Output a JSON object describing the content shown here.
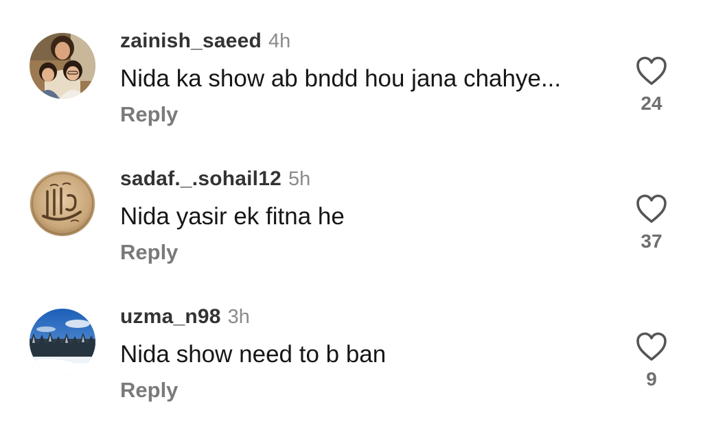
{
  "comments": [
    {
      "username": "zainish_saeed",
      "time": "4h",
      "text": "Nida ka show ab bndd hou jana chahye...",
      "reply_label": "Reply",
      "likes": "24",
      "avatar_icon": "family-photo-avatar"
    },
    {
      "username": "sadaf._.sohail12",
      "time": "5h",
      "text": "Nida yasir ek fitna he",
      "reply_label": "Reply",
      "likes": "37",
      "avatar_icon": "calligraphy-plaque-avatar"
    },
    {
      "username": "uzma_n98",
      "time": "3h",
      "text": "Nida show need to b ban",
      "reply_label": "Reply",
      "likes": "9",
      "avatar_icon": "snowy-forest-avatar"
    }
  ],
  "colors": {
    "username": "#333333",
    "timestamp": "#8a8a8a",
    "comment_text": "#161616",
    "reply": "#7a7a7a",
    "like_count": "#6e6e6e",
    "heart_outline": "#555555"
  }
}
